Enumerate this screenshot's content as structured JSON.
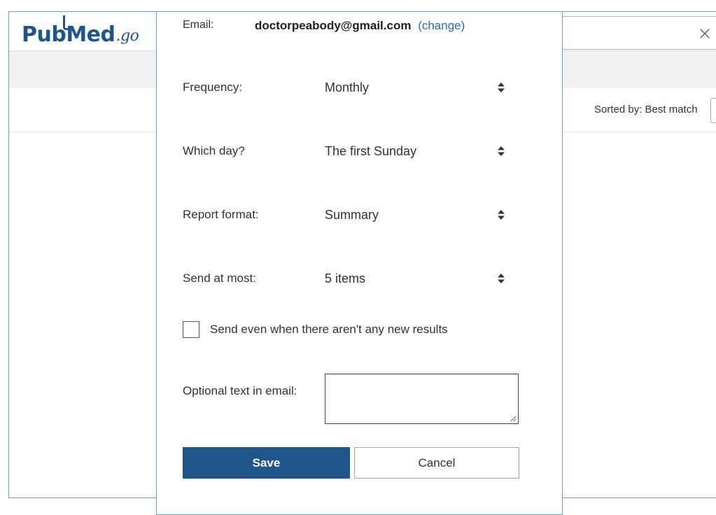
{
  "background": {
    "logo_pub": "Pub",
    "logo_med": "Med",
    "logo_gov": ".go",
    "close_glyph": "×",
    "sorted_label": "Sorted by: Best match"
  },
  "modal": {
    "email_label": "Email:",
    "email_value": "doctorpeabody@gmail.com",
    "change_link": "(change)",
    "fields": [
      {
        "label": "Frequency:",
        "value": "Monthly"
      },
      {
        "label": "Which day?",
        "value": "The first Sunday"
      },
      {
        "label": "Report format:",
        "value": "Summary"
      },
      {
        "label": "Send at most:",
        "value": "5 items"
      }
    ],
    "checkbox_label": "Send even when there aren't any new results",
    "checkbox_checked": false,
    "optional_label": "Optional text in email:",
    "optional_value": "",
    "save_label": "Save",
    "cancel_label": "Cancel"
  },
  "colors": {
    "brand": "#20558a",
    "link": "#2b6cb0",
    "frame_border": "#6a9fd4"
  }
}
